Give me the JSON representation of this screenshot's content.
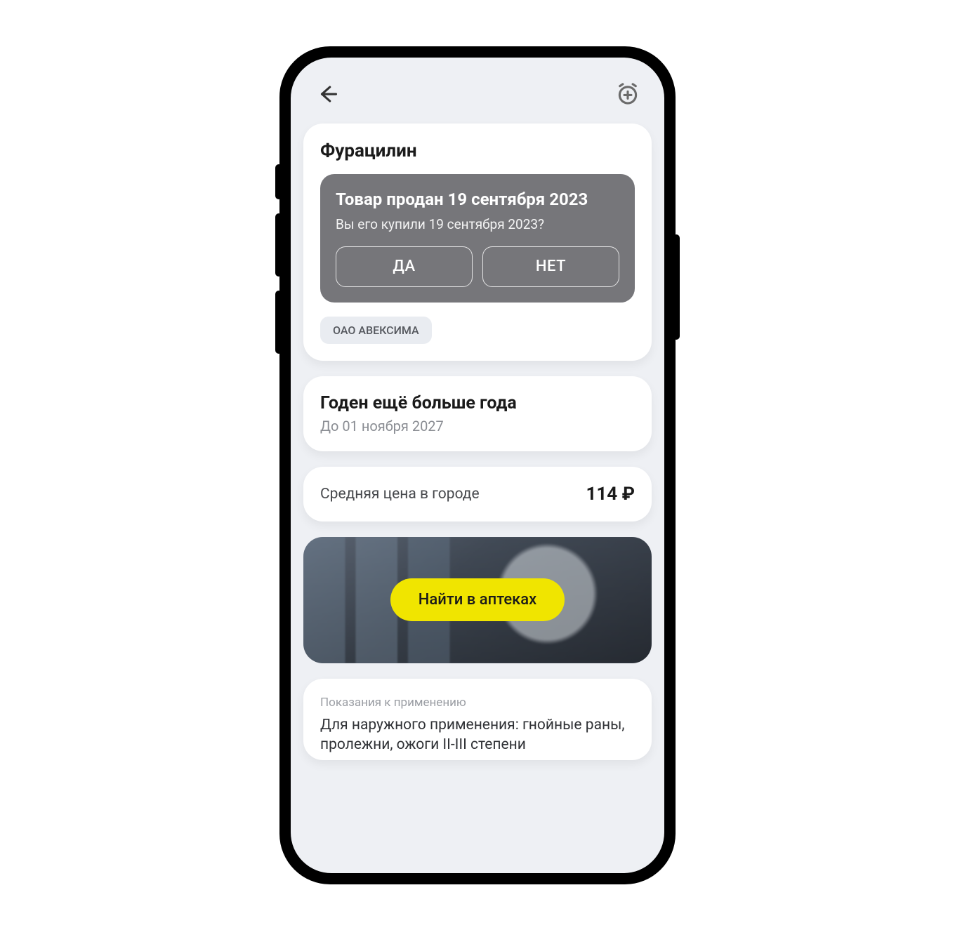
{
  "header": {
    "back_icon": "back-arrow",
    "alarm_icon": "alarm-add"
  },
  "product": {
    "name": "Фурацилин",
    "manufacturer": "ОАО АВЕКСИМА"
  },
  "sold_panel": {
    "title": "Товар продан 19 сентября 2023",
    "subtitle": "Вы его купили 19 сентября 2023?",
    "yes": "ДА",
    "no": "НЕТ"
  },
  "expiry": {
    "title": "Годен ещё больше года",
    "subtitle": "До 01 ноября 2027"
  },
  "price": {
    "label": "Средняя цена в городе",
    "value": "114 ₽"
  },
  "find": {
    "button": "Найти в аптеках"
  },
  "indications": {
    "label": "Показания к применению",
    "text": "Для наружного применения: гнойные раны, пролежни, ожоги II-III степени"
  }
}
